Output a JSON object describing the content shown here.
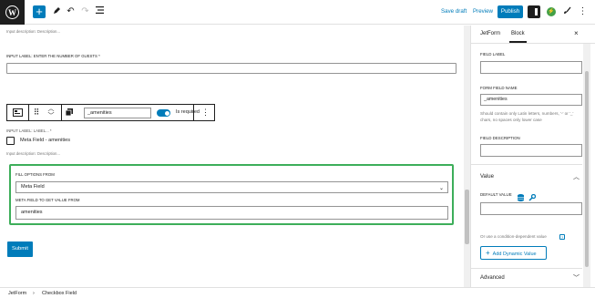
{
  "toolbar": {
    "save_draft": "Save draft",
    "preview": "Preview",
    "publish": "Publish"
  },
  "canvas": {
    "top_desc": "Input description:  Description...",
    "guests_label": "INPUT LABEL:  ENTER THE NUMBER OF GUESTS *",
    "block_toolbar": {
      "field_name": "_amenities",
      "required_label": "Is required"
    },
    "label_line": "INPUT LABEL:  LABEL...  *",
    "checkbox_label": "Meta Field - amenities",
    "desc2": "Input description:  Description...",
    "fill_options_label": "FILL OPTIONS FROM",
    "fill_options_value": "Meta Field",
    "meta_field_label": "META FIELD TO GET VALUE FROM",
    "meta_field_value": "amenities",
    "submit": "Submit"
  },
  "sidebar": {
    "tabs": [
      "JetForm",
      "Block"
    ],
    "active_tab": "Block",
    "field_label": "FIELD LABEL",
    "field_label_value": "",
    "form_field_name": "FORM FIELD NAME",
    "form_field_name_value": "_amenities",
    "field_name_help": "Should contain only Latin letters, numbers, '-' or '_' chars, no spaces only lower case",
    "field_description": "FIELD DESCRIPTION",
    "field_description_value": "",
    "value_section": "Value",
    "default_value": "DEFAULT VALUE",
    "default_value_input": "",
    "condition_text": "Or use a condition-dependent value",
    "dynamic_value_button": "Add Dynamic Value",
    "advanced_section": "Advanced"
  },
  "breadcrumb": [
    "JetForm",
    "Checkbox Field"
  ],
  "colors": {
    "accent": "#007cba",
    "highlight_border": "#3dae5a",
    "dark": "#1e1e1e"
  },
  "icons": [
    "wordpress-logo-icon",
    "plus-icon",
    "pen-icon",
    "undo-icon",
    "redo-icon",
    "list-view-icon",
    "settings-panel-icon",
    "jetplugins-icon",
    "brush-icon",
    "more-vertical-icon",
    "block-type-icon",
    "drag-icon",
    "move-up-down-icon",
    "copy-icon",
    "close-icon",
    "database-icon",
    "wrench-icon",
    "chevron-up-icon",
    "chevron-down-icon",
    "plus-circle-icon",
    "help-icon"
  ]
}
